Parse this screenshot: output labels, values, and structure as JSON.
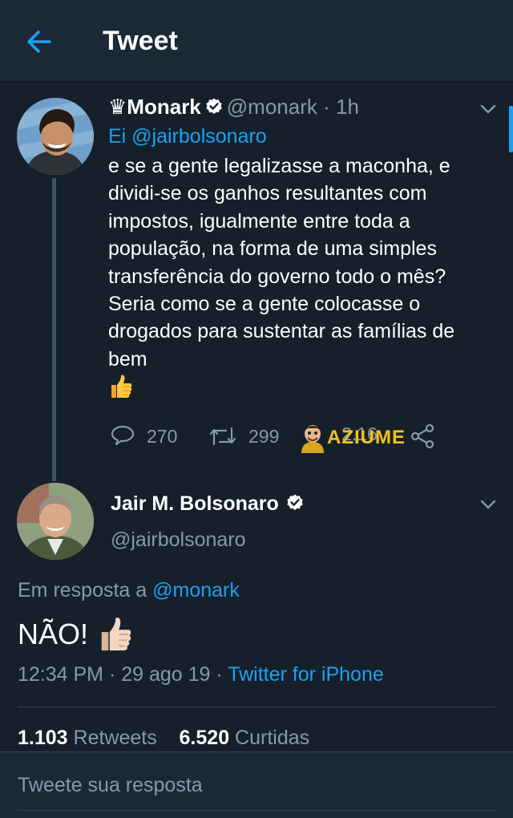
{
  "header": {
    "title": "Tweet"
  },
  "tweet1": {
    "name": "♛Monark",
    "handle": "@monark",
    "time": "· 1h",
    "mention": "Ei @jairbolsonaro",
    "body": " e se a gente legalizasse a maconha, e dividi-se os ganhos resultantes com impostos, igualmente entre toda a população, na forma de uma simples transferência do governo todo o mês? Seria como se a gente colocasse o drogados para sustentar as famílias de bem",
    "emoji": "thumbs-up",
    "replies": "270",
    "retweets": "299",
    "likes_partial": "2.16"
  },
  "watermark": {
    "text": "AZIUME"
  },
  "tweet2": {
    "name": "Jair M. Bolsonaro",
    "handle": "@jairbolsonaro",
    "reply_prefix": "Em resposta a ",
    "reply_mention": "@monark",
    "text": "NÃO!",
    "timestamp": "12:34 PM · 29 ago 19 · ",
    "source": "Twitter for iPhone",
    "retweets_count": "1.103",
    "retweets_label": " Retweets",
    "likes_count": "6.520",
    "likes_label": " Curtidas"
  },
  "reply_box": {
    "placeholder": "Tweete sua resposta"
  },
  "colors": {
    "background": "#15202b",
    "header": "#1b2836",
    "accent": "#1da1f2",
    "secondary_text": "#8899a6"
  }
}
